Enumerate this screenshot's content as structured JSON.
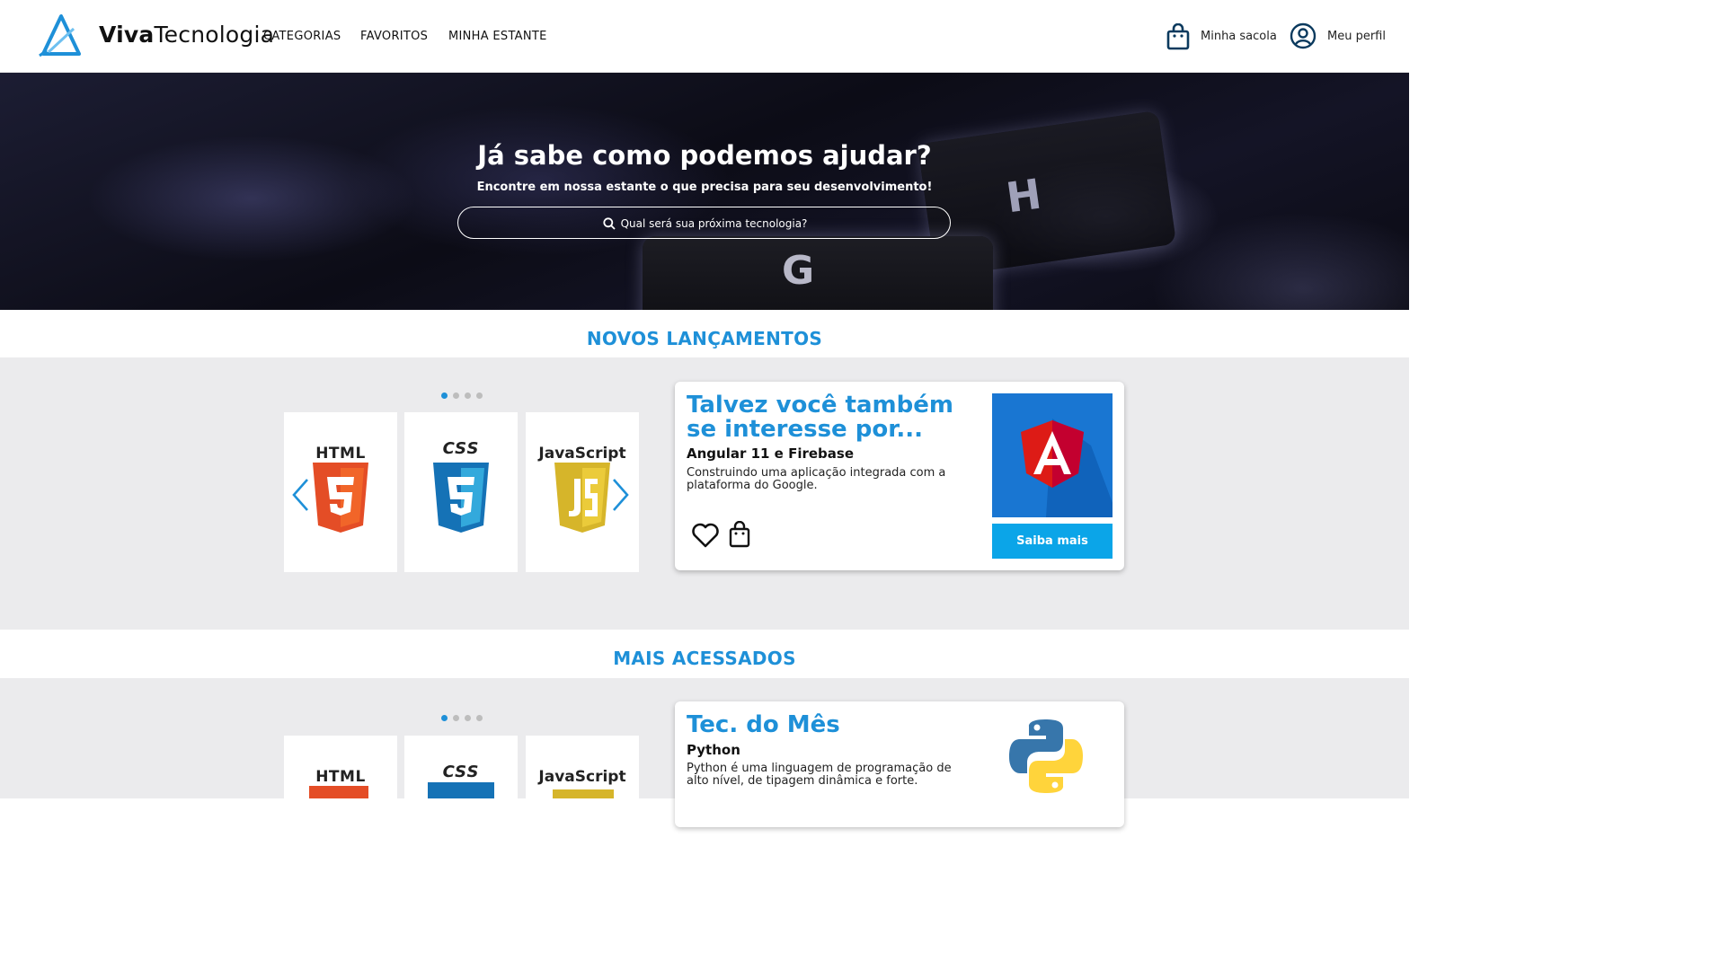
{
  "header": {
    "brand_bold": "Viva",
    "brand_regular": "Tecnologia",
    "nav": [
      "CATEGORIAS",
      "FAVORITOS",
      "MINHA ESTANTE"
    ],
    "bag_label": "Minha sacola",
    "profile_label": "Meu perfil"
  },
  "hero": {
    "title": "Já sabe como podemos ajudar?",
    "subtitle": "Encontre em nossa estante o que precisa para seu desenvolvimento!",
    "search_placeholder": "Qual será sua próxima tecnologia?",
    "key_letters": [
      "G",
      "H"
    ]
  },
  "sections": [
    {
      "title": "NOVOS LANÇAMENTOS",
      "carousel": {
        "dots": 4,
        "active_dot": 1,
        "tiles": [
          "HTML",
          "CSS",
          "JavaScript"
        ]
      },
      "card": {
        "title": "Talvez você também se interesse por...",
        "subtitle": "Angular 11 e Firebase",
        "description": "Construindo uma aplicação integrada com a plataforma do Google.",
        "button": "Saiba mais",
        "image_icon": "angular-logo"
      }
    },
    {
      "title": "MAIS ACESSADOS",
      "carousel": {
        "dots": 4,
        "active_dot": 1,
        "tiles": [
          "HTML",
          "CSS",
          "JavaScript"
        ]
      },
      "card": {
        "title": "Tec. do Mês",
        "subtitle": "Python",
        "description": "Python é uma linguagem de programação de alto nível, de tipagem dinâmica e forte.",
        "image_icon": "python-logo"
      }
    }
  ],
  "colors": {
    "accent": "#1e90d8",
    "button": "#0ba5e8",
    "band": "#ebebed",
    "html": "#e44d26",
    "css": "#1572b6",
    "js": "#d6b52a",
    "angular_red": "#dd1b16",
    "angular_bg": "#1976d2"
  }
}
